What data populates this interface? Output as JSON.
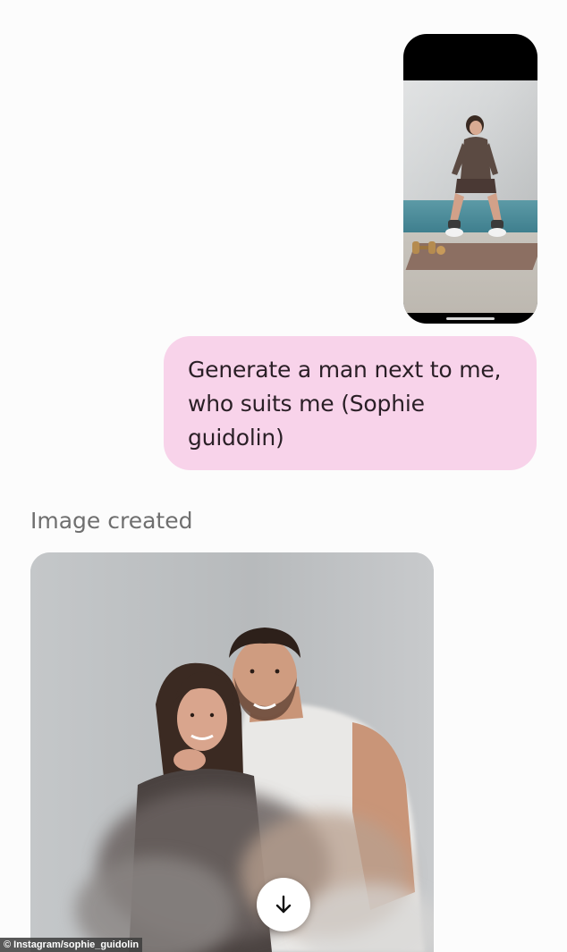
{
  "conversation": {
    "user_upload": {
      "icon": "uploaded-photo-thumbnail"
    },
    "user_message": {
      "lines": [
        "Generate a man next to me,",
        "who suits me (Sophie",
        "guidolin)"
      ]
    },
    "assistant": {
      "status_label": "Image created",
      "download_icon": "arrow-down-icon"
    }
  },
  "credit": "© Instagram/sophie_guidolin",
  "colors": {
    "background": "#fcfcfc",
    "user_bubble": "#f8d3ea",
    "status_text": "#6f6f6f"
  }
}
